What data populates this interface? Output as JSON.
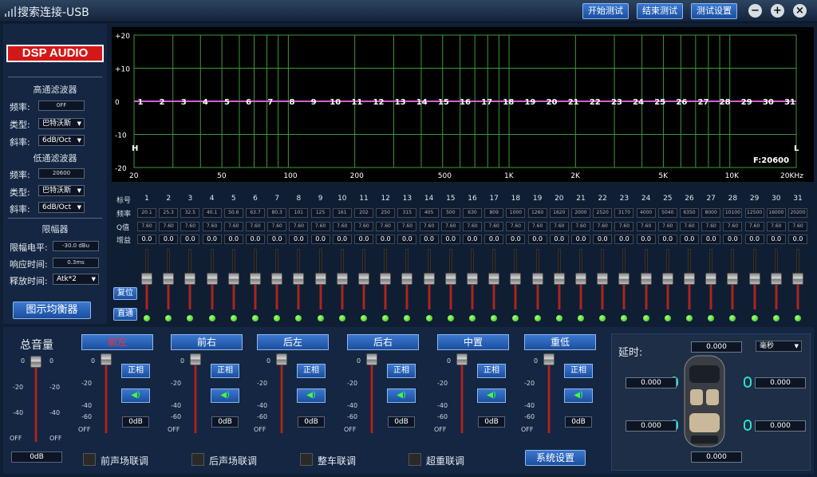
{
  "window": {
    "title": "搜索连接-USB",
    "buttons": [
      "开始测试",
      "结束测试",
      "测试设置"
    ],
    "controls": [
      "−",
      "+",
      "×"
    ]
  },
  "left": {
    "logo": "DSP AUDIO",
    "highpass": {
      "title": "高通滤波器",
      "freq_label": "频率:",
      "freq": "0FF",
      "type_label": "类型:",
      "type": "巴特沃斯",
      "slope_label": "斜率:",
      "slope": "6dB/Oct"
    },
    "lowpass": {
      "title": "低通滤波器",
      "freq_label": "频率:",
      "freq": "20600",
      "type_label": "类型:",
      "type": "巴特沃斯",
      "slope_label": "斜率:",
      "slope": "6dB/Oct"
    },
    "limiter": {
      "title": "限幅器",
      "level_label": "限幅电平:",
      "level": "-30.0 dBu",
      "attack_label": "响应时间:",
      "attack": "0.3ms",
      "release_label": "释放时间:",
      "release": "Atk*2"
    },
    "eq_button": "图示均衡器"
  },
  "graph": {
    "y_labels": [
      "+20",
      "+10",
      "0",
      "-10",
      "-20"
    ],
    "x_labels": [
      "20",
      "50",
      "100",
      "200",
      "500",
      "1K",
      "2K",
      "5K",
      "10K",
      "20KHz"
    ],
    "markers": [
      "1",
      "2",
      "3",
      "4",
      "5",
      "6",
      "7",
      "8",
      "9",
      "10",
      "11",
      "12",
      "13",
      "14",
      "15",
      "16",
      "17",
      "18",
      "19",
      "20",
      "21",
      "22",
      "23",
      "24",
      "25",
      "26",
      "27",
      "28",
      "29",
      "30",
      "31"
    ],
    "h_marker": "H",
    "l_marker": "L",
    "freq_readout": "F:20600",
    "curve_color": "#d060d0"
  },
  "eq": {
    "row_labels": [
      "标号",
      "频率",
      "Q值",
      "增益"
    ],
    "freqs": [
      "20.1",
      "25.3",
      "32.5",
      "40.1",
      "50.6",
      "63.7",
      "80.3",
      "101",
      "125",
      "161",
      "202",
      "250",
      "315",
      "405",
      "500",
      "630",
      "809",
      "1000",
      "1260",
      "1620",
      "2000",
      "2520",
      "3170",
      "4000",
      "5040",
      "6350",
      "8000",
      "10100",
      "12500",
      "16000",
      "20200"
    ],
    "q": "7.60",
    "gain": "0.0",
    "reset": "复位",
    "bypass": "直通"
  },
  "bottom": {
    "master": {
      "title": "总音量",
      "scale": [
        "0",
        "-20",
        "-40",
        "OFF"
      ],
      "value": "0dB"
    },
    "channels": [
      {
        "name": "前左",
        "active": true,
        "phase": "正相",
        "db": "0dB"
      },
      {
        "name": "前右",
        "phase": "正相",
        "db": "0dB"
      },
      {
        "name": "后左",
        "phase": "正相",
        "db": "0dB"
      },
      {
        "name": "后右",
        "phase": "正相",
        "db": "0dB"
      },
      {
        "name": "中置",
        "phase": "正相",
        "db": "0dB"
      },
      {
        "name": "重低",
        "phase": "正相",
        "db": "0dB"
      }
    ],
    "ch_scale": [
      "0",
      "-20",
      "-40",
      "-60",
      "OFF"
    ],
    "links": [
      "前声场联调",
      "后声场联调",
      "整车联调",
      "超重联调"
    ],
    "system": "系统设置"
  },
  "delay": {
    "title": "延时:",
    "unit": "毫秒",
    "values": [
      "0.000",
      "0.000",
      "0.000",
      "0.000",
      "0.000",
      "0.000"
    ]
  }
}
